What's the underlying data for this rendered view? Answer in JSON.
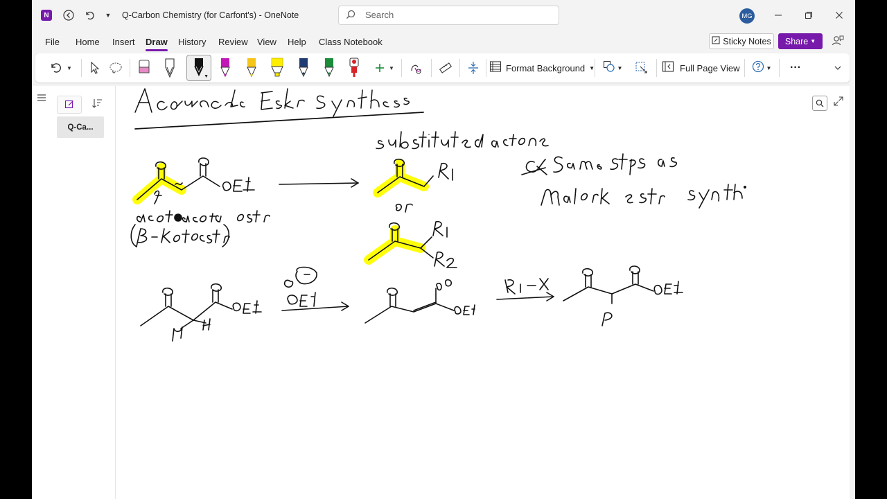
{
  "window": {
    "app_logo": "N",
    "title": "Q-Carbon Chemistry (for Carfont's)  -  OneNote",
    "search_placeholder": "Search",
    "avatar_initials": "MG"
  },
  "menu": {
    "items": [
      "File",
      "Home",
      "Insert",
      "Draw",
      "History",
      "Review",
      "View",
      "Help",
      "Class Notebook"
    ],
    "active": "Draw",
    "sticky_notes": "Sticky Notes",
    "share": "Share"
  },
  "ribbon": {
    "format_background": "Format Background",
    "full_page_view": "Full Page View",
    "more": "···",
    "pens": [
      {
        "name": "black-pen",
        "color": "#111111"
      },
      {
        "name": "magenta-pen",
        "color": "#c218b8"
      },
      {
        "name": "yellow-pen",
        "color": "#f5c518"
      },
      {
        "name": "yellow-highlighter",
        "color": "#ffee00"
      },
      {
        "name": "navy-pen",
        "color": "#1f3b73"
      },
      {
        "name": "green-pen",
        "color": "#1a8c3a"
      },
      {
        "name": "red-marker",
        "color": "#d8232a"
      }
    ]
  },
  "sidebar": {
    "page_label": "Q-Ca..."
  },
  "colors": {
    "accent": "#7719aa",
    "highlight": "#ffff00",
    "ink": "#111111"
  }
}
